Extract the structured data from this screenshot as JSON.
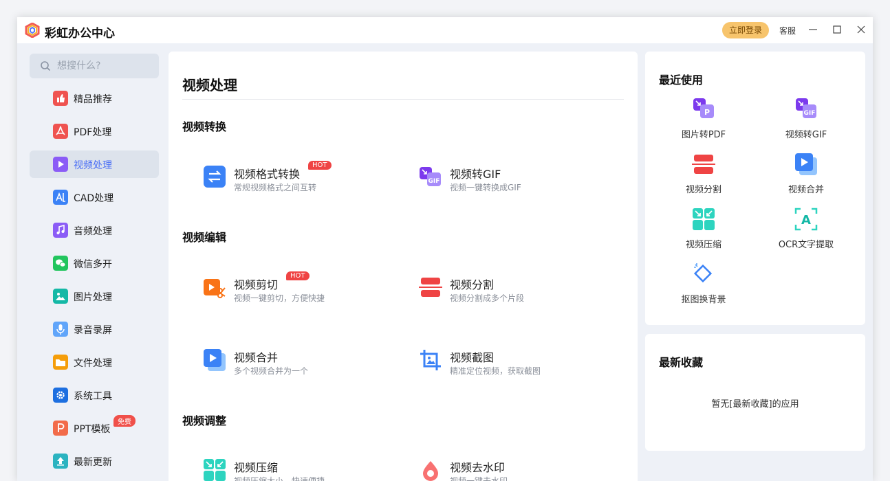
{
  "app": {
    "title": "彩虹办公中心",
    "login_label": "立即登录",
    "service_label": "客服"
  },
  "search": {
    "placeholder": "想搜什么?"
  },
  "sidebar": {
    "items": [
      {
        "label": "精品推荐",
        "icon": "thumbs-up-icon",
        "color": "#ef5350"
      },
      {
        "label": "PDF处理",
        "icon": "pdf-icon",
        "color": "#ef5350"
      },
      {
        "label": "视频处理",
        "icon": "video-play-icon",
        "color": "#8b5cf6",
        "active": true
      },
      {
        "label": "CAD处理",
        "icon": "cad-icon",
        "color": "#3b82f6"
      },
      {
        "label": "音频处理",
        "icon": "music-icon",
        "color": "#8b5cf6"
      },
      {
        "label": "微信多开",
        "icon": "wechat-icon",
        "color": "#22c55e"
      },
      {
        "label": "图片处理",
        "icon": "image-icon",
        "color": "#14b8a6"
      },
      {
        "label": "录音录屏",
        "icon": "microphone-icon",
        "color": "#60a5fa"
      },
      {
        "label": "文件处理",
        "icon": "folder-icon",
        "color": "#f59e0b"
      },
      {
        "label": "系统工具",
        "icon": "gear-icon",
        "color": "#1d6fe0"
      },
      {
        "label": "PPT模板",
        "icon": "ppt-icon",
        "color": "#f26b4a",
        "badge": "免费"
      },
      {
        "label": "最新更新",
        "icon": "update-icon",
        "color": "#2bb3c0"
      }
    ]
  },
  "main": {
    "title": "视频处理",
    "sections": [
      {
        "title": "视频转换",
        "tools": [
          {
            "name": "视频格式转换",
            "desc": "常规视频格式之间互转",
            "badge": "HOT",
            "icon": "convert-icon"
          },
          {
            "name": "视频转GIF",
            "desc": "视频一键转换成GIF",
            "icon": "gif-icon"
          }
        ]
      },
      {
        "title": "视频编辑",
        "tools": [
          {
            "name": "视频剪切",
            "desc": "视频一键剪切，方便快捷",
            "badge": "HOT",
            "icon": "scissors-icon"
          },
          {
            "name": "视频分割",
            "desc": "视频分割成多个片段",
            "icon": "split-icon"
          },
          {
            "name": "视频合并",
            "desc": "多个视频合并为一个",
            "icon": "merge-icon"
          },
          {
            "name": "视频截图",
            "desc": "精准定位视频，获取截图",
            "icon": "crop-icon"
          }
        ]
      },
      {
        "title": "视频调整",
        "tools": [
          {
            "name": "视频压缩",
            "desc": "视频压缩大小，快速便捷",
            "icon": "compress-icon"
          },
          {
            "name": "视频去水印",
            "desc": "视频一键去水印",
            "icon": "watermark-icon"
          }
        ]
      }
    ]
  },
  "recent": {
    "title": "最近使用",
    "items": [
      {
        "label": "图片转PDF",
        "icon": "image-to-pdf-icon"
      },
      {
        "label": "视频转GIF",
        "icon": "gif-icon"
      },
      {
        "label": "视频分割",
        "icon": "split-icon"
      },
      {
        "label": "视频合并",
        "icon": "merge-icon"
      },
      {
        "label": "视频压缩",
        "icon": "compress-icon"
      },
      {
        "label": "OCR文字提取",
        "icon": "ocr-icon"
      },
      {
        "label": "抠图换背景",
        "icon": "cutout-icon"
      }
    ]
  },
  "favorites": {
    "title": "最新收藏",
    "empty_text": "暂无[最新收藏]的应用"
  }
}
